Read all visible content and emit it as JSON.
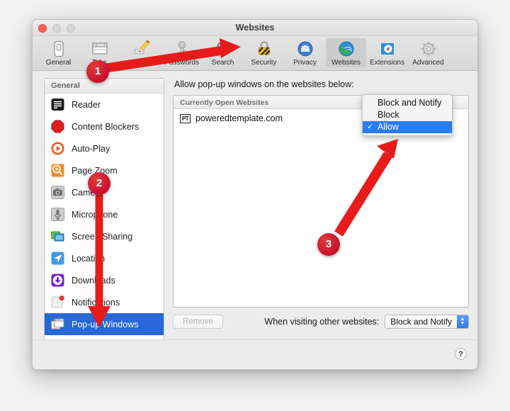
{
  "window": {
    "title": "Websites",
    "traffic_lights": [
      "close-button",
      "minimize-button",
      "maximize-button"
    ]
  },
  "toolbar": {
    "items": [
      {
        "label": "General",
        "icon": "general-icon",
        "selected": false
      },
      {
        "label": "Tabs",
        "icon": "tabs-icon",
        "selected": false
      },
      {
        "label": "AutoFill",
        "icon": "autofill-icon",
        "selected": false
      },
      {
        "label": "Passwords",
        "icon": "passwords-icon",
        "selected": false
      },
      {
        "label": "Search",
        "icon": "search-icon",
        "selected": false
      },
      {
        "label": "Security",
        "icon": "security-icon",
        "selected": false
      },
      {
        "label": "Privacy",
        "icon": "privacy-icon",
        "selected": false
      },
      {
        "label": "Websites",
        "icon": "websites-icon",
        "selected": true
      },
      {
        "label": "Extensions",
        "icon": "extensions-icon",
        "selected": false
      },
      {
        "label": "Advanced",
        "icon": "advanced-icon",
        "selected": false
      }
    ]
  },
  "sidebar": {
    "header": "General",
    "items": [
      {
        "label": "Reader",
        "icon": "reader-icon",
        "active": false
      },
      {
        "label": "Content Blockers",
        "icon": "content-blockers-icon",
        "active": false
      },
      {
        "label": "Auto-Play",
        "icon": "auto-play-icon",
        "active": false
      },
      {
        "label": "Page Zoom",
        "icon": "page-zoom-icon",
        "active": false
      },
      {
        "label": "Camera",
        "icon": "camera-icon",
        "active": false
      },
      {
        "label": "Microphone",
        "icon": "microphone-icon",
        "active": false
      },
      {
        "label": "Screen Sharing",
        "icon": "screen-sharing-icon",
        "active": false
      },
      {
        "label": "Location",
        "icon": "location-icon",
        "active": false
      },
      {
        "label": "Downloads",
        "icon": "downloads-icon",
        "active": false
      },
      {
        "label": "Notifications",
        "icon": "notifications-icon",
        "active": false
      },
      {
        "label": "Pop-up Windows",
        "icon": "popup-windows-icon",
        "active": true
      }
    ]
  },
  "pane": {
    "title": "Allow pop-up windows on the websites below:",
    "list_header": "Currently Open Websites",
    "rows": [
      {
        "favicon_text": "PT",
        "site": "poweredtemplate.com",
        "value": "Allow"
      }
    ],
    "remove_label": "Remove",
    "other_sites_label": "When visiting other websites:",
    "other_sites_value": "Block and Notify",
    "help_label": "?"
  },
  "menu": {
    "items": [
      {
        "label": "Block and Notify",
        "checked": false,
        "selected": false
      },
      {
        "label": "Block",
        "checked": false,
        "selected": false
      },
      {
        "label": "Allow",
        "checked": true,
        "selected": true
      }
    ],
    "check_glyph": "✓"
  },
  "annotations": {
    "markers": [
      {
        "number": "1",
        "target": "websites-toolbar-tab"
      },
      {
        "number": "2",
        "target": "popup-windows-sidebar-item"
      },
      {
        "number": "3",
        "target": "allow-menu-item"
      }
    ],
    "color": "#c8102e"
  }
}
